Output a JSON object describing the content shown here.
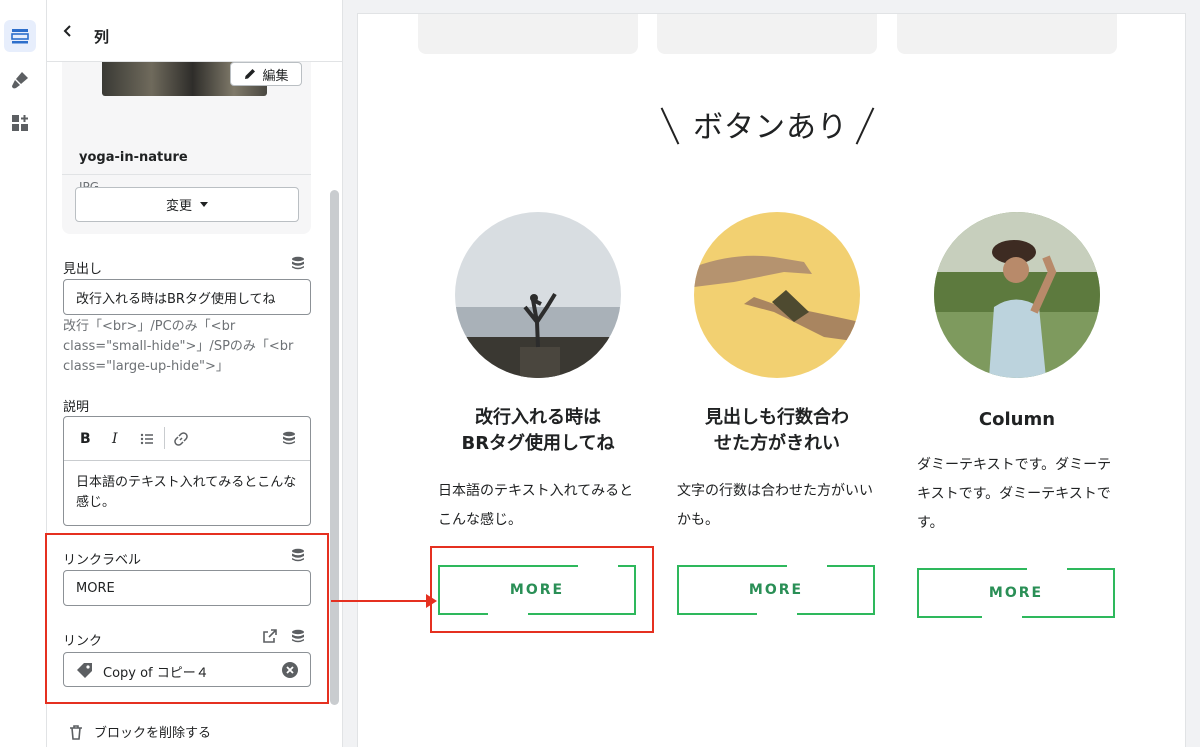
{
  "panel": {
    "title": "列",
    "image_card": {
      "edit_label": "編集",
      "file_name": "yoga-in-nature",
      "file_type": "JPG",
      "change_label": "変更"
    },
    "heading": {
      "label": "見出し",
      "value": "改行入れる時はBRタグ使用してね",
      "help": "改行「<br>」/PCのみ「<br class=\"small-hide\">」/SPのみ「<br class=\"large-up-hide\">」"
    },
    "description": {
      "label": "説明",
      "toolbar": {
        "bold": "B",
        "italic": "I"
      },
      "value": "日本語のテキスト入れてみるとこんな感じ。"
    },
    "link_label": {
      "label": "リンクラベル",
      "value": "MORE"
    },
    "link": {
      "label": "リンク",
      "value": "Copy of コピー４"
    },
    "delete_label": "ブロックを削除する"
  },
  "preview": {
    "section_title": "ボタンあり",
    "columns": [
      {
        "title_line1": "改行入れる時は",
        "title_line2": "BRタグ使用してね",
        "text": "日本語のテキスト入れてみるとこんな感じ。",
        "button": "MORE",
        "image": "yoga-in-nature"
      },
      {
        "title_line1": "見出しも行数合わ",
        "title_line2": "せた方がきれい",
        "text": "文字の行数は合わせた方がいいかも。",
        "button": "MORE",
        "image": "hands-yellow"
      },
      {
        "title_line1": "Column",
        "title_line2": "",
        "text": "ダミーテキストです。ダミーテキストです。ダミーテキストです。",
        "button": "MORE",
        "image": "man-field"
      }
    ]
  },
  "colors": {
    "accent_green": "#2eb85c",
    "highlight_red": "#e53020",
    "rail_active": "#e7eefc"
  },
  "icons": [
    "sections-icon",
    "theme-brush-icon",
    "apps-add-icon",
    "back-chevron-icon",
    "pencil-icon",
    "caret-down-icon",
    "database-icon",
    "list-icon",
    "link-icon",
    "external-link-icon",
    "tag-icon",
    "clear-icon",
    "trash-icon"
  ]
}
